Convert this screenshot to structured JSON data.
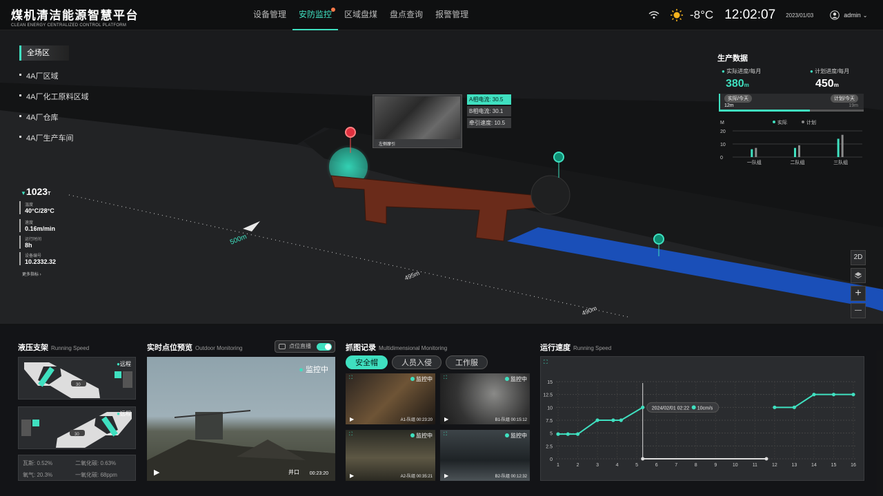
{
  "header": {
    "title": "煤机清洁能源智慧平台",
    "subtitle": "CLEAN ENERGY CENTRALIZED CONTROL PLATFORM",
    "nav": [
      "设备管理",
      "安防监控",
      "区域盘煤",
      "盘点查询",
      "报警管理"
    ],
    "active": "安防监控",
    "temperature": "-8°C",
    "time": "12:02:07",
    "date": "2023/01/03",
    "user": "admin"
  },
  "regions": {
    "header": "全场区",
    "items": [
      "4A厂区域",
      "4A厂化工原料区域",
      "4A厂仓库",
      "4A厂生产车间"
    ]
  },
  "scene": {
    "tonnage": "1023",
    "tonnage_unit": "T",
    "metrics": [
      {
        "label": "温度",
        "value": "40°C/28°C"
      },
      {
        "label": "速度",
        "value": "0.16m/min"
      },
      {
        "label": "运行时间",
        "value": "8h"
      },
      {
        "label": "设备编号",
        "value": "10.2332.32"
      }
    ],
    "more": "更多指标",
    "distances": [
      "500m",
      "495m",
      "490m"
    ],
    "camera_caption": "左侧摩引",
    "readings": [
      {
        "label": "A相电流:",
        "value": "30.5"
      },
      {
        "label": "B相电流:",
        "value": "30.1"
      },
      {
        "label": "牵引速度:",
        "value": "10.5"
      }
    ],
    "controls": {
      "mode": "2D",
      "zoom_in": "+",
      "zoom_out": "—"
    }
  },
  "production": {
    "title": "生产数据",
    "actual": {
      "label": "实际进度/每月",
      "value": "380",
      "unit": "m",
      "today_label": "实际/今天",
      "today_value": "12m"
    },
    "plan": {
      "label": "计划进度/每月",
      "value": "450",
      "unit": "m",
      "today_label": "计划/今天",
      "today_value": "19m"
    },
    "progress_ratio": 0.63,
    "chart_data": {
      "type": "bar",
      "ylabel": "M",
      "yticks": [
        "20",
        "10",
        "0"
      ],
      "ylim": [
        0,
        20
      ],
      "categories": [
        "一队组",
        "二队组",
        "三队组"
      ],
      "series": [
        {
          "name": "实际",
          "color": "#3fe0c0",
          "values": [
            6,
            7,
            14
          ]
        },
        {
          "name": "计划",
          "color": "#8a8a8a",
          "values": [
            7,
            9,
            17
          ]
        }
      ]
    }
  },
  "hydraulic": {
    "title": "液压支架",
    "subtitle": "Running Speed",
    "status": "远程",
    "value": "30",
    "gas": [
      {
        "label": "瓦斯:",
        "value": "0.52%"
      },
      {
        "label": "二氧化碳:",
        "value": "0.63%"
      },
      {
        "label": "氧气:",
        "value": "20.3%"
      },
      {
        "label": "一氧化碳:",
        "value": "68ppm"
      }
    ]
  },
  "preview": {
    "title": "实时点位预览",
    "subtitle": "Outdoor Monitoring",
    "toggle_label": "点位直播",
    "status": "监控中",
    "location": "井口",
    "time": "00:23:20"
  },
  "capture": {
    "title": "抓图记录",
    "subtitle": "Multidimensional Monitoring",
    "tabs": [
      "安全帽",
      "人员入侵",
      "工作服"
    ],
    "cams": [
      {
        "status": "监控中",
        "name": "A1-队组",
        "time": "00:23:20"
      },
      {
        "status": "监控中",
        "name": "B1-队组",
        "time": "00:15:12"
      },
      {
        "status": "监控中",
        "name": "A2-队组",
        "time": "00:35:21"
      },
      {
        "status": "监控中",
        "name": "B2-队组",
        "time": "00:12:32"
      }
    ]
  },
  "speed": {
    "title": "运行速度",
    "subtitle": "Running Speed",
    "chart_data": {
      "type": "line",
      "ylim": [
        0,
        15
      ],
      "yticks": [
        0,
        2.5,
        5,
        7.5,
        10,
        12.5,
        15
      ],
      "xlim": [
        1,
        16
      ],
      "series": [
        {
          "name": "",
          "segments": [
            [
              [
                1,
                4.8
              ],
              [
                1.5,
                4.8
              ],
              [
                2,
                4.8
              ],
              [
                3,
                7.5
              ],
              [
                3.8,
                7.5
              ],
              [
                4.2,
                7.5
              ],
              [
                5.3,
                10
              ]
            ],
            [
              [
                12,
                10
              ],
              [
                13,
                10
              ],
              [
                14,
                12.5
              ],
              [
                15,
                12.5
              ],
              [
                16,
                12.5
              ]
            ]
          ]
        }
      ],
      "tooltip": {
        "x": 5.3,
        "date": "2024/02/01 02:22",
        "value": "10cm/s"
      }
    }
  }
}
